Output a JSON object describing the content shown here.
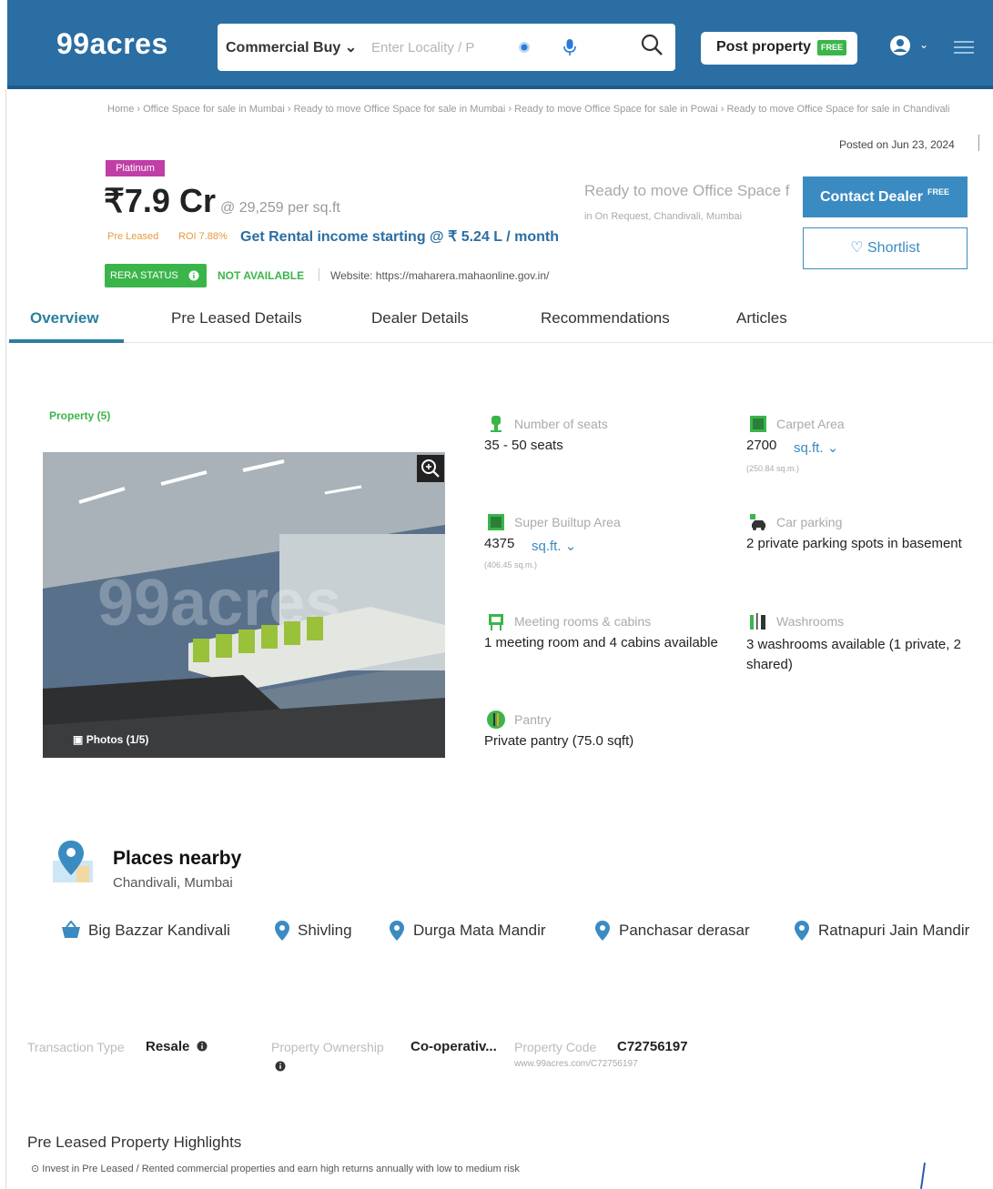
{
  "header": {
    "logo": "99acres",
    "search_type": "Commercial Buy",
    "search_placeholder": "Enter Locality / P",
    "post_property_label": "Post property",
    "free_badge": "FREE"
  },
  "breadcrumb": "Home › Office Space for sale in Mumbai › Ready to move Office Space for sale in Mumbai › Ready to move Office Space for sale in Powai › Ready to move Office Space for sale in Chandivali",
  "posted_on": "Posted on Jun 23, 2024",
  "listing": {
    "tier_badge": "Platinum",
    "price": "₹7.9 Cr",
    "price_per": "@ 29,259 per sq.ft",
    "pre_leased_tag": "Pre Leased",
    "roi_tag": "ROI 7.88%",
    "rental_income": "Get Rental income starting @ ₹ 5.24 L / month",
    "rera_status": "RERA STATUS",
    "rera_value": "NOT AVAILABLE",
    "website": "Website: https://maharera.mahaonline.gov.in/",
    "headline": "Ready to move Office Space f",
    "subline": "in On Request, Chandivali, Mumbai"
  },
  "actions": {
    "contact_label": "Contact Dealer",
    "contact_free": "FREE",
    "shortlist_label": "Shortlist"
  },
  "tabs": [
    {
      "label": "Overview"
    },
    {
      "label": "Pre Leased Details"
    },
    {
      "label": "Dealer Details"
    },
    {
      "label": "Recommendations"
    },
    {
      "label": "Articles"
    }
  ],
  "property": {
    "section_label": "Property (5)",
    "photo_watermark": "99acres",
    "photos_count": "Photos (1/5)",
    "attributes": {
      "seats": {
        "label": "Number of seats",
        "value": "35 - 50 seats"
      },
      "carpet": {
        "label": "Carpet Area",
        "value": "2700",
        "unit": "sq.ft.",
        "sub": "(250.84 sq.m.)"
      },
      "super_builtup": {
        "label": "Super Builtup Area",
        "value": "4375",
        "unit": "sq.ft.",
        "sub": "(406.45 sq.m.)"
      },
      "parking": {
        "label": "Car parking",
        "value": "2 private parking spots in basement"
      },
      "meeting": {
        "label": "Meeting rooms & cabins",
        "value": "1 meeting room and 4 cabins available"
      },
      "washrooms": {
        "label": "Washrooms",
        "value": "3 washrooms available (1 private, 2 shared)"
      },
      "pantry": {
        "label": "Pantry",
        "value": "Private pantry (75.0 sqft)"
      }
    }
  },
  "places": {
    "title": "Places nearby",
    "subtitle": "Chandivali, Mumbai",
    "items": [
      {
        "label": "Big Bazzar Kandivali"
      },
      {
        "label": "Shivling"
      },
      {
        "label": "Durga Mata Mandir"
      },
      {
        "label": "Panchasar derasar"
      },
      {
        "label": "Ratnapuri Jain Mandir"
      }
    ]
  },
  "transaction": {
    "type_label": "Transaction Type",
    "type_value": "Resale",
    "ownership_label": "Property Ownership",
    "ownership_value": "Co-operativ...",
    "code_label": "Property Code",
    "code_value": "C72756197",
    "code_url": "www.99acres.com/C72756197"
  },
  "highlights": {
    "title": "Pre Leased Property Highlights",
    "text": "Invest in Pre Leased / Rented commercial properties and earn high returns annually with low to medium risk"
  },
  "colors": {
    "brand_blue": "#2a6ea3",
    "accent_green": "#3bb54a",
    "platinum": "#c03ea6",
    "contact_blue": "#3a8bc1"
  }
}
